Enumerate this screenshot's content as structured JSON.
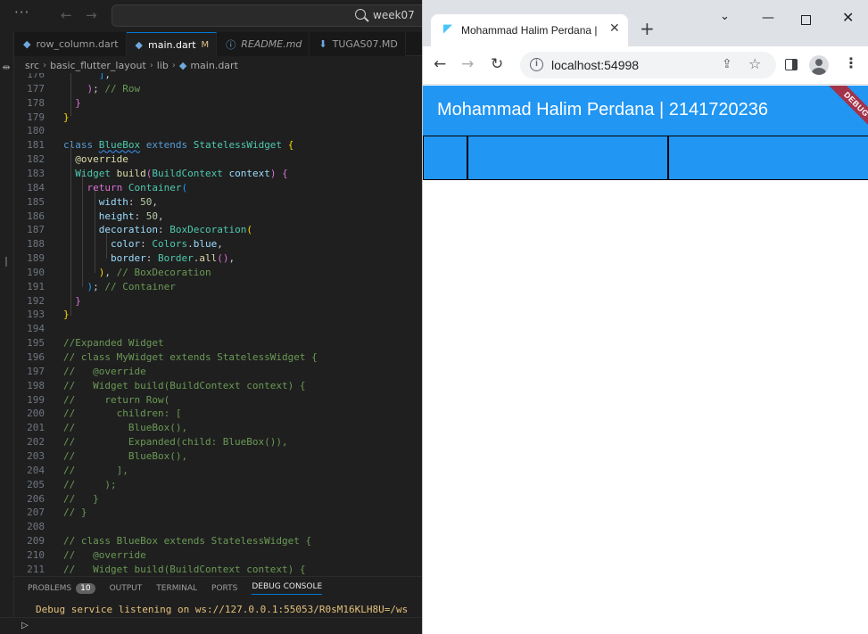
{
  "vscode": {
    "titlebar": {
      "search_text": "week07"
    },
    "tabs": [
      {
        "label": "row_column.dart",
        "icon": "dart-file-icon",
        "active": false,
        "italic": false,
        "modified": ""
      },
      {
        "label": "main.dart",
        "icon": "dart-file-icon",
        "active": true,
        "italic": false,
        "modified": "M"
      },
      {
        "label": "README.md",
        "icon": "info-icon",
        "active": false,
        "italic": true,
        "modified": ""
      },
      {
        "label": "TUGAS07.MD",
        "icon": "markdown-download-icon",
        "active": false,
        "italic": false,
        "modified": ""
      }
    ],
    "breadcrumb": [
      "src",
      "basic_flutter_layout",
      "lib",
      "main.dart"
    ],
    "code_lines": [
      {
        "n": "176",
        "html": "      <span class=\"b\">]</span>,"
      },
      {
        "n": "177",
        "html": "    <span class=\"p\">)</span>; <span class=\"m\">// Row</span>"
      },
      {
        "n": "178",
        "html": "  <span class=\"p\">}</span>"
      },
      {
        "n": "179",
        "html": "<span class=\"y\">}</span>"
      },
      {
        "n": "180",
        "html": ""
      },
      {
        "n": "181",
        "html": "<span class=\"k\">class</span> <span class=\"c u\">BlueBox</span> <span class=\"k\">extends</span> <span class=\"c\">StatelessWidget</span> <span class=\"y\">{</span>"
      },
      {
        "n": "182",
        "html": "  <span class=\"f\">@override</span>"
      },
      {
        "n": "183",
        "html": "  <span class=\"c\">Widget</span> <span class=\"f\">build</span><span class=\"p\">(</span><span class=\"c\">BuildContext</span> <span class=\"v\">context</span><span class=\"p\">)</span> <span class=\"p\">{</span>"
      },
      {
        "n": "184",
        "html": "    <span class=\"p\">return</span> <span class=\"c\">Container</span><span class=\"b\">(</span>"
      },
      {
        "n": "185",
        "html": "      <span class=\"v\">width</span>: <span class=\"n\">50</span>,"
      },
      {
        "n": "186",
        "html": "      <span class=\"v\">height</span>: <span class=\"n\">50</span>,"
      },
      {
        "n": "187",
        "html": "      <span class=\"v\">decoration</span>: <span class=\"c\">BoxDecoration</span><span class=\"y\">(</span>"
      },
      {
        "n": "188",
        "html": "        <span class=\"v\">color</span>: <span class=\"c\">Colors</span>.<span class=\"v\">blue</span>,"
      },
      {
        "n": "189",
        "html": "        <span class=\"v\">border</span>: <span class=\"c\">Border</span>.<span class=\"f\">all</span><span class=\"p\">()</span>,"
      },
      {
        "n": "190",
        "html": "      <span class=\"y\">)</span>, <span class=\"m\">// BoxDecoration</span>"
      },
      {
        "n": "191",
        "html": "    <span class=\"b\">)</span>; <span class=\"m\">// Container</span>"
      },
      {
        "n": "192",
        "html": "  <span class=\"p\">}</span>"
      },
      {
        "n": "193",
        "html": "<span class=\"y\">}</span>"
      },
      {
        "n": "194",
        "html": ""
      },
      {
        "n": "195",
        "html": "<span class=\"m\">//Expanded Widget</span>"
      },
      {
        "n": "196",
        "html": "<span class=\"m\">// class MyWidget extends StatelessWidget {</span>"
      },
      {
        "n": "197",
        "html": "<span class=\"m\">//   @override</span>"
      },
      {
        "n": "198",
        "html": "<span class=\"m\">//   Widget build(BuildContext context) {</span>"
      },
      {
        "n": "199",
        "html": "<span class=\"m\">//     return Row(</span>"
      },
      {
        "n": "200",
        "html": "<span class=\"m\">//       children: [</span>"
      },
      {
        "n": "201",
        "html": "<span class=\"m\">//         BlueBox(),</span>"
      },
      {
        "n": "202",
        "html": "<span class=\"m\">//         Expanded(child: BlueBox()),</span>"
      },
      {
        "n": "203",
        "html": "<span class=\"m\">//         BlueBox(),</span>"
      },
      {
        "n": "204",
        "html": "<span class=\"m\">//       ],</span>"
      },
      {
        "n": "205",
        "html": "<span class=\"m\">//     );</span>"
      },
      {
        "n": "206",
        "html": "<span class=\"m\">//   }</span>"
      },
      {
        "n": "207",
        "html": "<span class=\"m\">// }</span>"
      },
      {
        "n": "208",
        "html": ""
      },
      {
        "n": "209",
        "html": "<span class=\"m\">// class BlueBox extends StatelessWidget {</span>"
      },
      {
        "n": "210",
        "html": "<span class=\"m\">//   @override</span>"
      },
      {
        "n": "211",
        "html": "<span class=\"m\">//   Widget build(BuildContext context) {</span>"
      }
    ],
    "panel": {
      "tabs": [
        {
          "label": "PROBLEMS",
          "badge": "10",
          "active": false
        },
        {
          "label": "OUTPUT",
          "badge": "",
          "active": false
        },
        {
          "label": "TERMINAL",
          "badge": "",
          "active": false
        },
        {
          "label": "PORTS",
          "badge": "",
          "active": false
        },
        {
          "label": "DEBUG CONSOLE",
          "badge": "",
          "active": true
        }
      ],
      "console_text": "Debug service listening on ws://127.0.0.1:55053/R0sM16KLH8U=/ws"
    }
  },
  "chrome": {
    "tab_title": "Mohammad Halim Perdana | 2141720236",
    "url": "localhost:54998",
    "app": {
      "title": "Mohammad Halim Perdana | 2141720236",
      "debug_banner": "DEBUG",
      "primary_color": "#2196f3",
      "row_boxes": [
        {
          "flex": "fixed"
        },
        {
          "flex": "expanded"
        },
        {
          "flex": "expanded"
        }
      ]
    }
  }
}
